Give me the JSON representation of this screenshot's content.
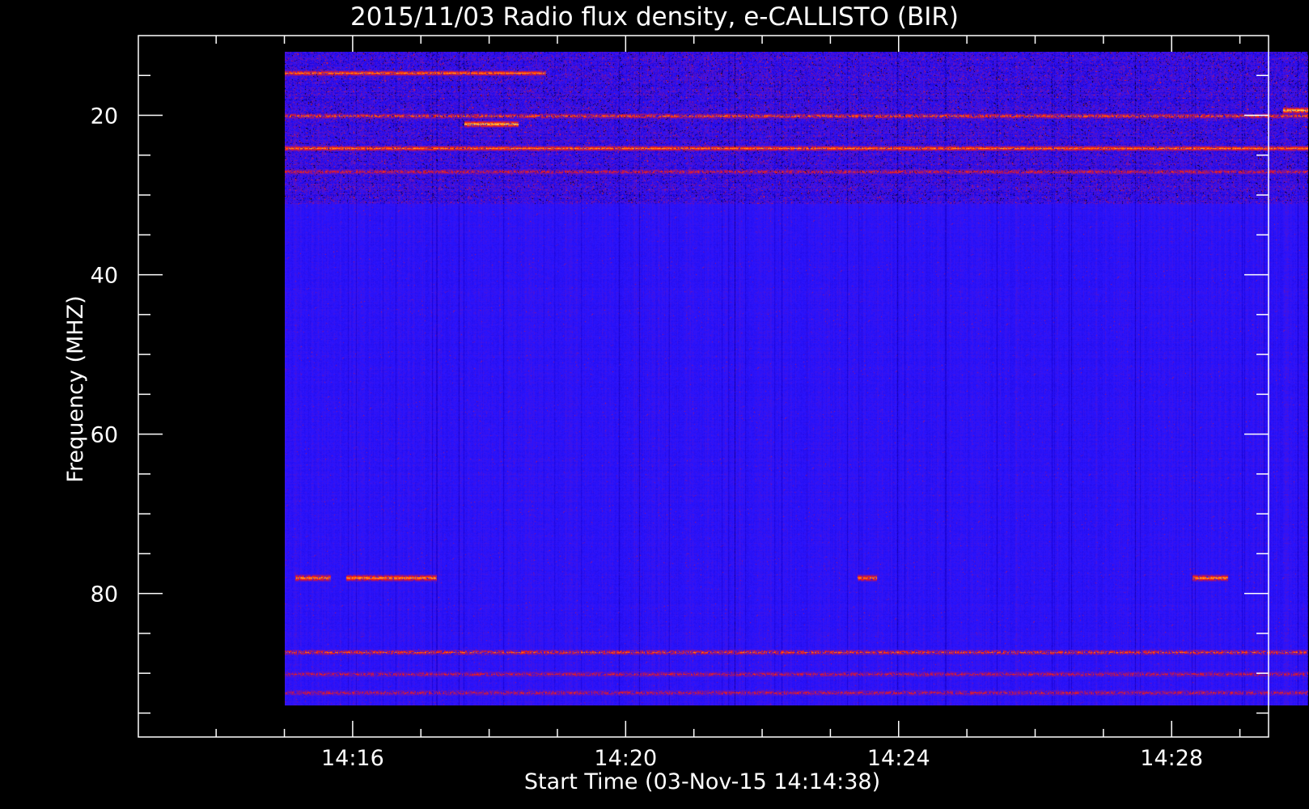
{
  "chart_data": {
    "type": "heatmap",
    "title": "2015/11/03  Radio flux density, e-CALLISTO (BIR)",
    "xlabel": "Start Time (03-Nov-15 14:14:38)",
    "ylabel": "Frequency (MHZ)",
    "x_ticks": [
      {
        "label": "14:16",
        "value": 1.37
      },
      {
        "label": "14:20",
        "value": 5.37
      },
      {
        "label": "14:24",
        "value": 9.37
      },
      {
        "label": "14:28",
        "value": 13.37
      }
    ],
    "y_ticks": [
      {
        "label": "20",
        "value": 20
      },
      {
        "label": "40",
        "value": 40
      },
      {
        "label": "60",
        "value": 60
      },
      {
        "label": "80",
        "value": 80
      }
    ],
    "xlim_minutes_from_start": [
      -1.77,
      14.79
    ],
    "ylim_mhz": [
      10,
      98
    ],
    "data_xrange_minutes_from_start": [
      0.37,
      15.37
    ],
    "data_yrange_mhz": [
      12,
      94
    ],
    "y_inverted": true,
    "colormap": [
      "#000000",
      "#1a00c8",
      "#2a14ff",
      "#8a1090",
      "#ff2000",
      "#ffa020",
      "#ffff90"
    ],
    "background_level_color": "#2a14ff",
    "features": [
      {
        "name": "bright band",
        "freq_mhz": 14.6,
        "t_start": 0.37,
        "t_end": 4.2,
        "intensity": 0.8
      },
      {
        "name": "bright band",
        "freq_mhz": 20.0,
        "t_start": 0.37,
        "t_end": 15.37,
        "intensity": 0.75
      },
      {
        "name": "bright band",
        "freq_mhz": 24.1,
        "t_start": 0.37,
        "t_end": 15.37,
        "intensity": 0.8
      },
      {
        "name": "band",
        "freq_mhz": 27.0,
        "t_start": 0.37,
        "t_end": 15.37,
        "intensity": 0.55
      },
      {
        "name": "interference",
        "freq_mhz": 78.0,
        "t_start": 0.53,
        "t_end": 1.05,
        "intensity": 0.85
      },
      {
        "name": "interference",
        "freq_mhz": 78.0,
        "t_start": 1.27,
        "t_end": 2.6,
        "intensity": 0.85
      },
      {
        "name": "interference",
        "freq_mhz": 78.0,
        "t_start": 8.77,
        "t_end": 9.05,
        "intensity": 0.8
      },
      {
        "name": "interference",
        "freq_mhz": 78.0,
        "t_start": 13.68,
        "t_end": 14.2,
        "intensity": 0.85
      },
      {
        "name": "band",
        "freq_mhz": 87.3,
        "t_start": 0.37,
        "t_end": 15.37,
        "intensity": 0.7
      },
      {
        "name": "faint band",
        "freq_mhz": 90.0,
        "t_start": 0.37,
        "t_end": 15.37,
        "intensity": 0.5
      },
      {
        "name": "faint band",
        "freq_mhz": 92.4,
        "t_start": 0.37,
        "t_end": 15.37,
        "intensity": 0.5
      },
      {
        "name": "burst",
        "freq_mhz": 21.0,
        "t_start": 3.0,
        "t_end": 3.8,
        "intensity": 1.0
      },
      {
        "name": "burst",
        "freq_mhz": 19.3,
        "t_start": 15.0,
        "t_end": 15.37,
        "intensity": 1.0
      }
    ]
  }
}
